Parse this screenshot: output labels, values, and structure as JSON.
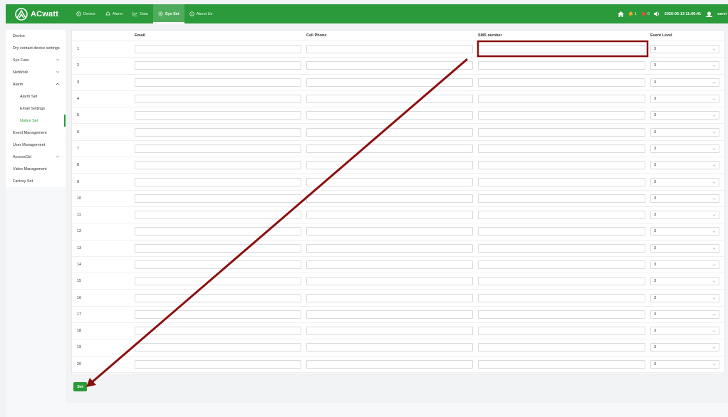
{
  "app": {
    "logo_text": "ACwatt"
  },
  "nav": [
    {
      "label": "Device",
      "active": false
    },
    {
      "label": "Alarm",
      "active": false
    },
    {
      "label": "Data",
      "active": false
    },
    {
      "label": "Sys Set",
      "active": true
    },
    {
      "label": "About Us",
      "active": false
    }
  ],
  "header": {
    "alarm_red_count": "1",
    "alarm_orange_count": "0",
    "datetime": "2026-05-13 11:06:41",
    "user": "servi"
  },
  "sidebar": {
    "items": [
      {
        "label": "Device",
        "sub": false,
        "chevron": ""
      },
      {
        "label": "Dry contact device settings",
        "sub": false,
        "chevron": ""
      },
      {
        "label": "Sys Func",
        "sub": false,
        "chevron": "down"
      },
      {
        "label": "NetWork",
        "sub": false,
        "chevron": "down"
      },
      {
        "label": "Alarm",
        "sub": false,
        "chevron": "up"
      },
      {
        "label": "Alarm Set",
        "sub": true,
        "chevron": ""
      },
      {
        "label": "Email Settings",
        "sub": true,
        "chevron": ""
      },
      {
        "label": "Notice Set",
        "sub": true,
        "chevron": "",
        "active": true
      },
      {
        "label": "Event Management",
        "sub": false,
        "chevron": ""
      },
      {
        "label": "User Management",
        "sub": false,
        "chevron": ""
      },
      {
        "label": "AccessCtrl",
        "sub": false,
        "chevron": "down"
      },
      {
        "label": "Video Management",
        "sub": false,
        "chevron": ""
      },
      {
        "label": "Factory Set",
        "sub": false,
        "chevron": ""
      }
    ]
  },
  "table": {
    "headers": {
      "email": "Email",
      "phone": "Cell Phone",
      "sms": "SMS number",
      "level": "Event Level"
    },
    "rows": [
      {
        "num": "1",
        "email": "",
        "phone": "",
        "sms": "",
        "level": "3"
      },
      {
        "num": "2",
        "email": "",
        "phone": "",
        "sms": "",
        "level": "3"
      },
      {
        "num": "3",
        "email": "",
        "phone": "",
        "sms": "",
        "level": "3"
      },
      {
        "num": "4",
        "email": "",
        "phone": "",
        "sms": "",
        "level": "3"
      },
      {
        "num": "5",
        "email": "",
        "phone": "",
        "sms": "",
        "level": "3"
      },
      {
        "num": "6",
        "email": "",
        "phone": "",
        "sms": "",
        "level": "3"
      },
      {
        "num": "7",
        "email": "",
        "phone": "",
        "sms": "",
        "level": "3"
      },
      {
        "num": "8",
        "email": "",
        "phone": "",
        "sms": "",
        "level": "3"
      },
      {
        "num": "9",
        "email": "",
        "phone": "",
        "sms": "",
        "level": "3"
      },
      {
        "num": "10",
        "email": "",
        "phone": "",
        "sms": "",
        "level": "3"
      },
      {
        "num": "11",
        "email": "",
        "phone": "",
        "sms": "",
        "level": "3"
      },
      {
        "num": "12",
        "email": "",
        "phone": "",
        "sms": "",
        "level": "3"
      },
      {
        "num": "13",
        "email": "",
        "phone": "",
        "sms": "",
        "level": "3"
      },
      {
        "num": "14",
        "email": "",
        "phone": "",
        "sms": "",
        "level": "3"
      },
      {
        "num": "15",
        "email": "",
        "phone": "",
        "sms": "",
        "level": "3"
      },
      {
        "num": "16",
        "email": "",
        "phone": "",
        "sms": "",
        "level": "3"
      },
      {
        "num": "17",
        "email": "",
        "phone": "",
        "sms": "",
        "level": "3"
      },
      {
        "num": "18",
        "email": "",
        "phone": "",
        "sms": "",
        "level": "3"
      },
      {
        "num": "19",
        "email": "",
        "phone": "",
        "sms": "",
        "level": "3"
      },
      {
        "num": "20",
        "email": "",
        "phone": "",
        "sms": "",
        "level": "3"
      }
    ]
  },
  "actions": {
    "set_label": "Set"
  },
  "colors": {
    "brand": "#2a9a3a",
    "annotation": "#8b0f0f"
  }
}
